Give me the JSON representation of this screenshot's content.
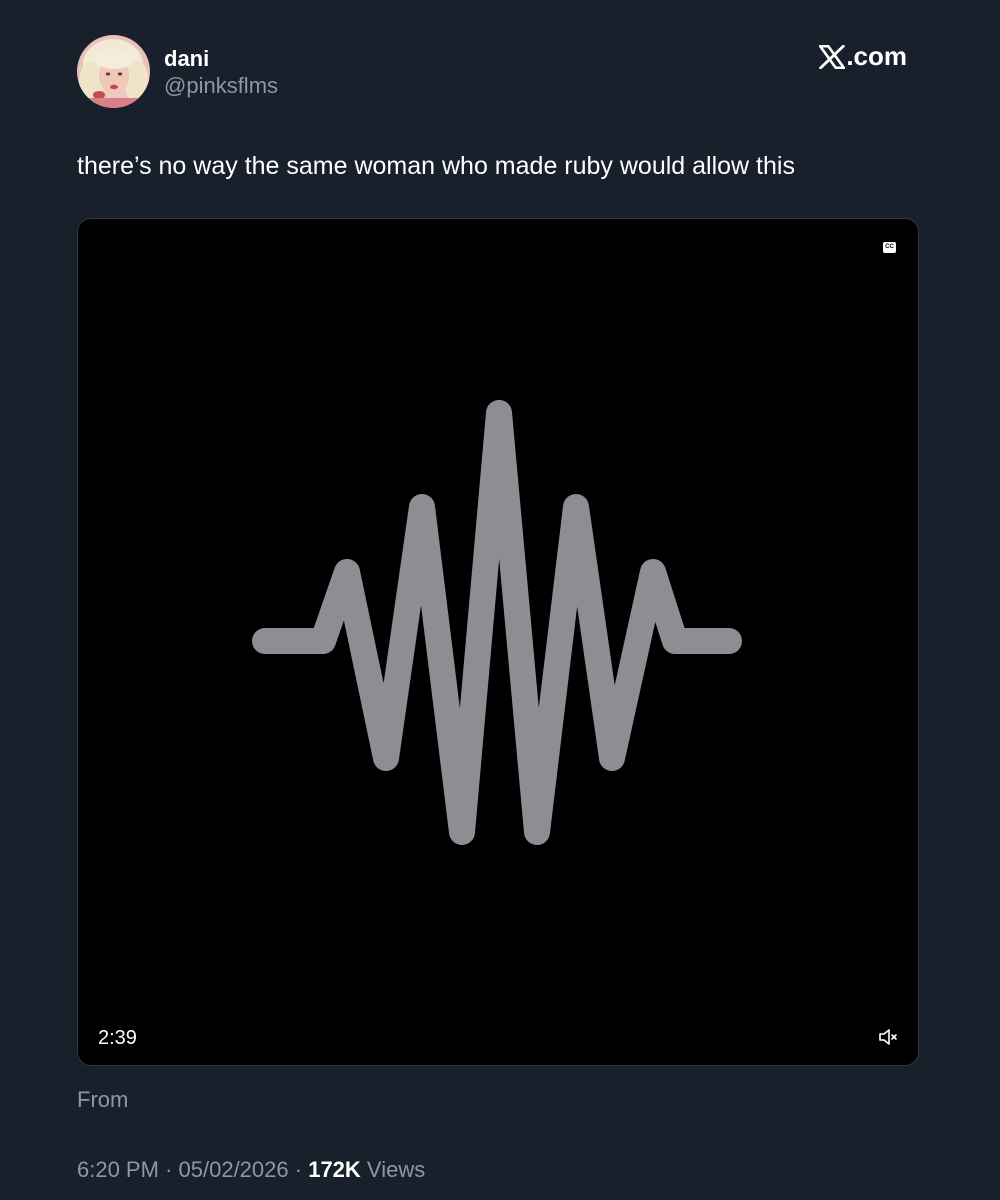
{
  "user": {
    "display_name": "dani",
    "handle": "@pinksflms",
    "avatar_icon": "profile-photo"
  },
  "brand": {
    "label": ".com",
    "icon": "x-logo-icon"
  },
  "tweet": {
    "text": "there’s no way the same woman who made ruby would allow this"
  },
  "video": {
    "duration": "2:39",
    "cc_label": "CC",
    "thumbnail_icon": "sound-wave-icon",
    "mute_icon": "speaker-muted-icon"
  },
  "from": {
    "label": "From"
  },
  "meta": {
    "time": "6:20 PM",
    "separator": "·",
    "date": "05/02/2026",
    "views_count": "172K",
    "views_label": "Views"
  },
  "colors": {
    "background": "#17202b",
    "text_primary": "#ffffff",
    "text_secondary": "#8b98a5",
    "waveform": "#8e8d93"
  }
}
